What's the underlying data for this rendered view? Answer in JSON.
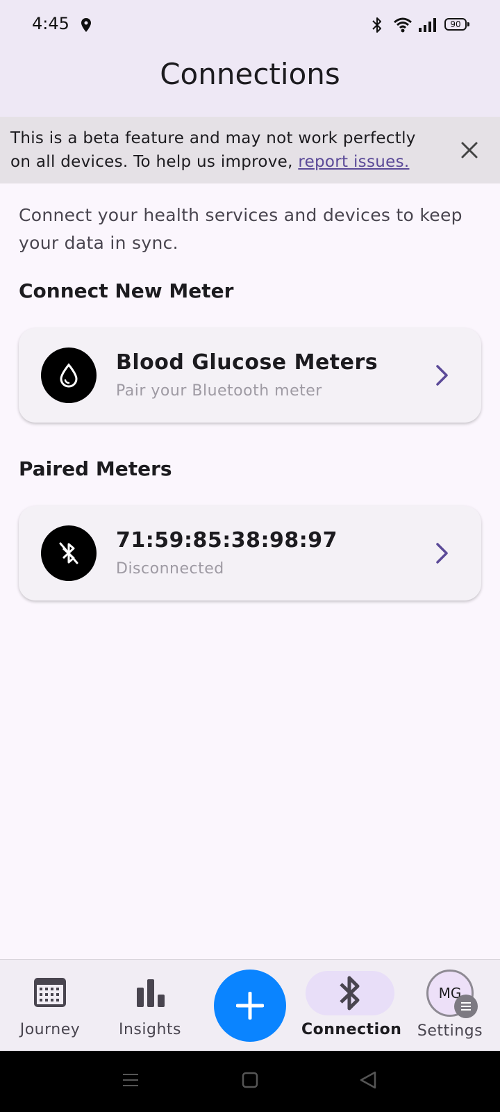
{
  "status_bar": {
    "time": "4:45",
    "battery": "90",
    "icons": [
      "location-icon",
      "bluetooth-icon",
      "wifi-icon",
      "signal-icon",
      "battery-icon"
    ]
  },
  "header": {
    "title": "Connections"
  },
  "banner": {
    "text": "This is a beta feature and may not work perfectly on all devices. To help us improve, ",
    "link": "report issues."
  },
  "intro": "Connect your health services and devices to keep your data in sync.",
  "connect_section": {
    "title": "Connect New Meter",
    "card": {
      "title": "Blood Glucose Meters",
      "subtitle": "Pair your Bluetooth meter",
      "icon": "water-drop-icon"
    }
  },
  "paired_section": {
    "title": "Paired Meters",
    "card": {
      "title": "71:59:85:38:98:97",
      "subtitle": "Disconnected",
      "icon": "bluetooth-disabled-icon"
    }
  },
  "bottom_nav": {
    "items": [
      {
        "label": "Journey",
        "icon": "calendar-icon"
      },
      {
        "label": "Insights",
        "icon": "bar-chart-icon"
      },
      {
        "label": "Connection",
        "icon": "bluetooth-icon"
      },
      {
        "label": "Settings",
        "icon": "avatar"
      }
    ],
    "active": "Connection",
    "avatar_initials": "MG",
    "fab_icon": "plus-icon"
  },
  "colors": {
    "accent": "#5B4A98",
    "fab": "#0A84FF",
    "active_pill": "#E8DEF8",
    "header_bg": "#EEE8F5"
  }
}
